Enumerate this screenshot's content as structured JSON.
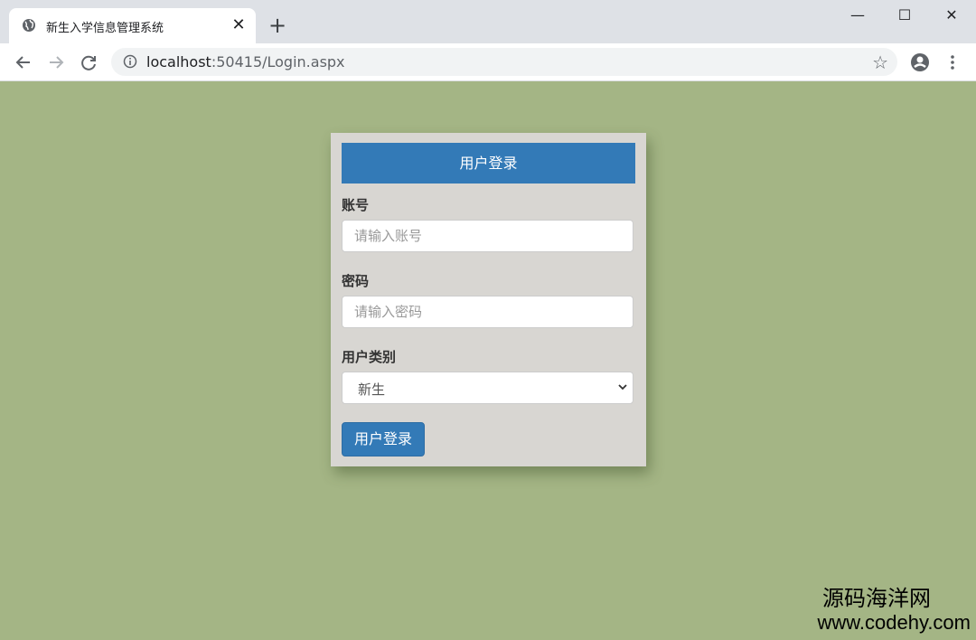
{
  "browser": {
    "tab_title": "新生入学信息管理系统",
    "url_host": "localhost",
    "url_path": ":50415/Login.aspx",
    "tab_close_icon": "close-icon",
    "new_tab_icon": "plus-icon",
    "back_icon": "arrow-left-icon",
    "forward_icon": "arrow-right-icon",
    "reload_icon": "reload-icon",
    "bookmark_icon": "star-icon",
    "profile_icon": "account-icon",
    "menu_icon": "more-vert-icon"
  },
  "login": {
    "header": "用户登录",
    "account_label": "账号",
    "account_placeholder": "请输入账号",
    "account_value": "",
    "password_label": "密码",
    "password_placeholder": "请输入密码",
    "password_value": "",
    "user_type_label": "用户类别",
    "user_type_selected": "新生",
    "submit_label": "用户登录"
  },
  "watermark": {
    "line1": "源码海洋网",
    "line2": "www.codehy.com"
  },
  "colors": {
    "page_background": "#a4b585",
    "card_background": "#d8d6d2",
    "primary": "#337ab7"
  }
}
